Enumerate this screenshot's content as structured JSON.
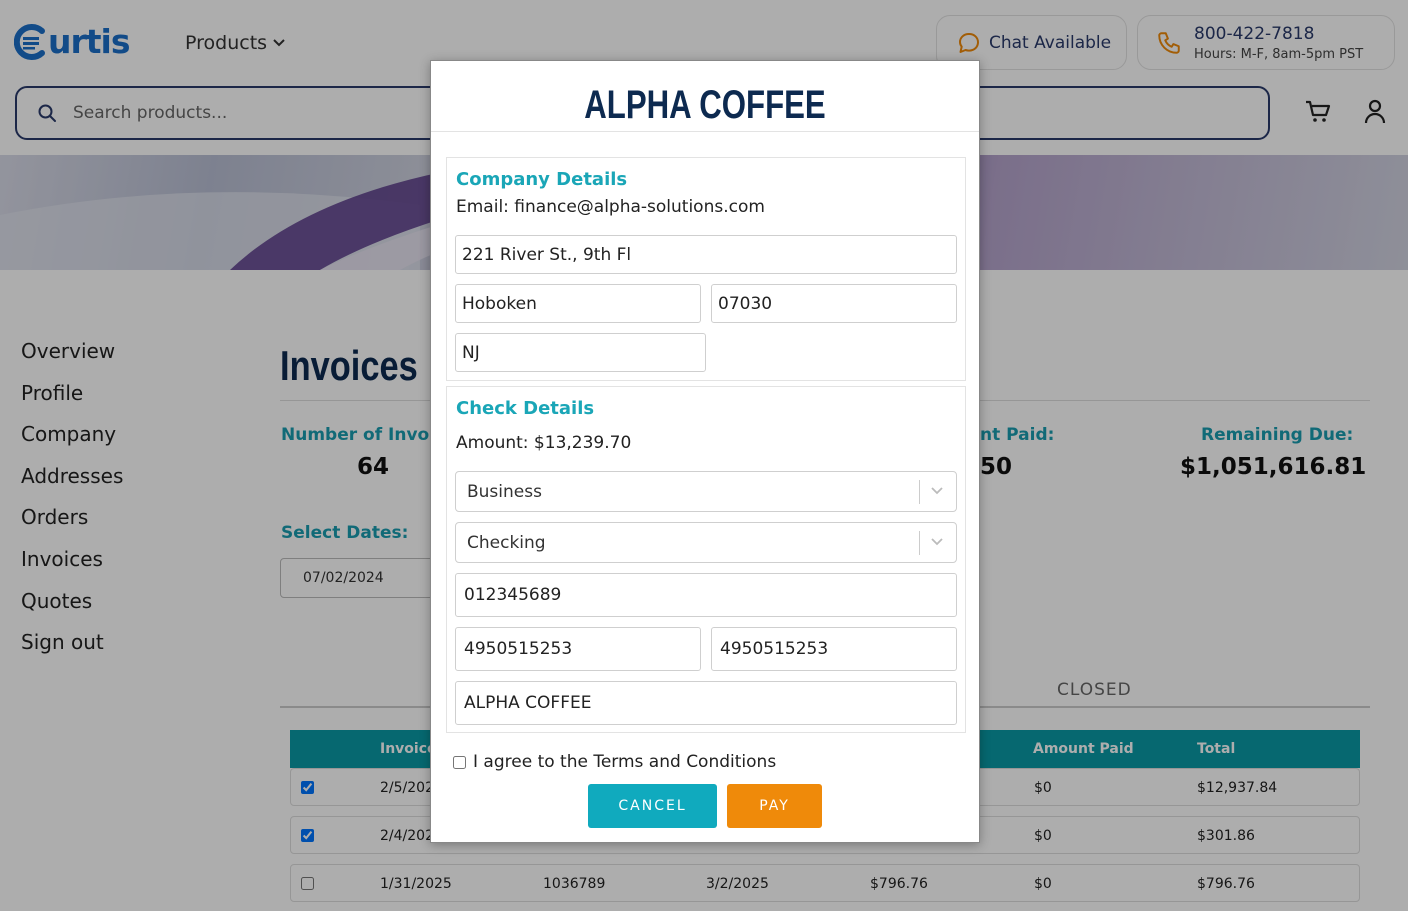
{
  "brand": {
    "logo_text": "urtis"
  },
  "header": {
    "products_label": "Products",
    "chat_label": "Chat Available",
    "phone_number": "800-422-7818",
    "phone_hours": "Hours: M-F, 8am-5pm PST",
    "search_placeholder": "Search products..."
  },
  "sidenav": {
    "items": [
      "Overview",
      "Profile",
      "Company",
      "Addresses",
      "Orders",
      "Invoices",
      "Quotes",
      "Sign out"
    ]
  },
  "main": {
    "title": "Invoices",
    "stats": {
      "number_of_invoices_label": "Number of Invo",
      "number_of_invoices_value": "64",
      "amount_paid_label": "nt Paid:",
      "amount_paid_value": "50",
      "remaining_due_label": "Remaining Due:",
      "remaining_due_value": "$1,051,616.81"
    },
    "select_dates_label": "Select Dates:",
    "date_from": "07/02/2024",
    "closed_tab": "CLOSED",
    "table": {
      "headers": {
        "invoice": "Invoice",
        "amount_paid": "Amount Paid",
        "total": "Total"
      },
      "rows": [
        {
          "checked": true,
          "date": "2/5/202",
          "invoice_no": "",
          "due": "",
          "amount": "",
          "amount_paid": "$0",
          "total": "$12,937.84"
        },
        {
          "checked": true,
          "date": "2/4/202",
          "invoice_no": "",
          "due": "",
          "amount": "",
          "amount_paid": "$0",
          "total": "$301.86"
        },
        {
          "checked": false,
          "date": "1/31/2025",
          "invoice_no": "1036789",
          "due": "3/2/2025",
          "amount": "$796.76",
          "amount_paid": "$0",
          "total": "$796.76"
        }
      ]
    }
  },
  "modal": {
    "title": "ALPHA COFFEE",
    "company": {
      "title": "Company Details",
      "email_line": "Email: finance@alpha-solutions.com",
      "street": "221 River St., 9th Fl",
      "city": "Hoboken",
      "zip": "07030",
      "state": "NJ"
    },
    "check": {
      "title": "Check Details",
      "amount_line": "Amount: $13,239.70",
      "account_type": "Business",
      "account_kind": "Checking",
      "routing_number": "012345689",
      "account_number": "4950515253",
      "account_number_confirm": "4950515253",
      "name_on_account": "ALPHA COFFEE"
    },
    "agree_label": "I agree to the Terms and Conditions",
    "agree_checked": false,
    "cancel_label": "CANCEL",
    "pay_label": "PAY"
  },
  "colors": {
    "brand_blue": "#1b6fc9",
    "navy": "#0d2a50",
    "teal": "#1aa6b7",
    "orange": "#ef8a0a",
    "table_head": "#0a9aa6"
  }
}
